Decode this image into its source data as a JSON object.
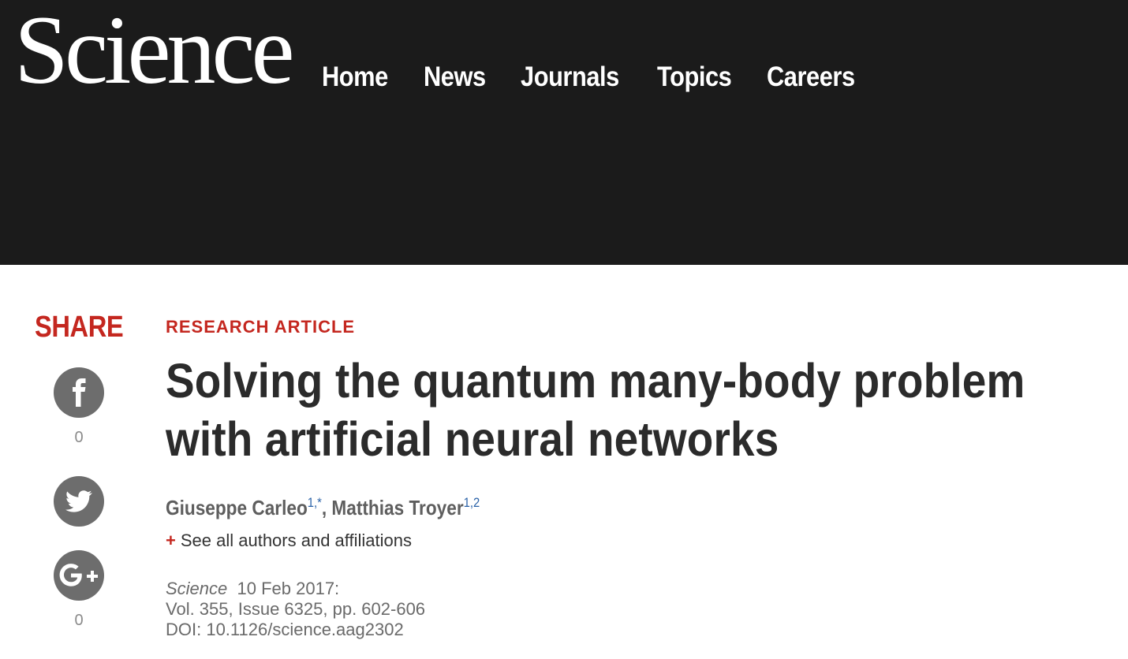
{
  "header": {
    "logo": "Science",
    "nav": [
      "Home",
      "News",
      "Journals",
      "Topics",
      "Careers"
    ]
  },
  "share": {
    "label": "SHARE",
    "facebook_count": "0",
    "googleplus_count": "0"
  },
  "article": {
    "kicker": "RESEARCH ARTICLE",
    "title": "Solving the quantum many-body problem with artificial neural networks",
    "authors": [
      {
        "name": "Giuseppe Carleo",
        "affiliations": "1,*"
      },
      {
        "name": "Matthias Troyer",
        "affiliations": "1,2"
      }
    ],
    "author_separator": ", ",
    "see_all": "See all authors and affiliations",
    "see_all_plus": "+",
    "citation": {
      "journal": "Science",
      "date": "10 Feb 2017:",
      "volume": "Vol. 355, Issue 6325, pp. 602-606",
      "doi": "DOI: 10.1126/science.aag2302"
    }
  },
  "colors": {
    "header_bg": "#1b1b1b",
    "accent_red": "#c4271f",
    "social_gray": "#6d6d6d",
    "superscript_blue": "#2a62a8"
  },
  "icons": [
    "facebook-icon",
    "twitter-icon",
    "google-plus-icon"
  ]
}
